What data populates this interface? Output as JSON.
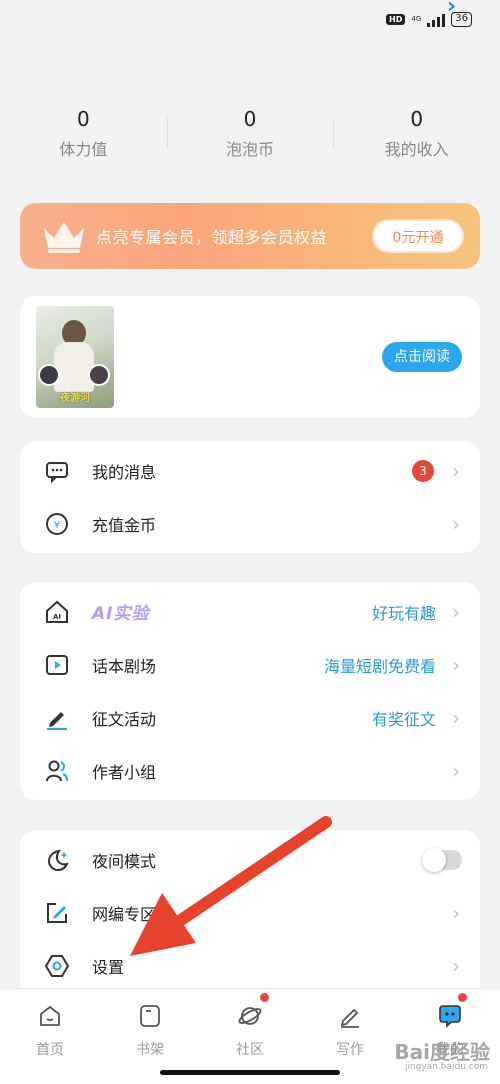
{
  "status_bar": {
    "hd": "HD",
    "network": "4G",
    "battery": "36"
  },
  "stats": [
    {
      "value": "0",
      "label": "体力值"
    },
    {
      "value": "0",
      "label": "泡泡币"
    },
    {
      "value": "0",
      "label": "我的收入"
    }
  ],
  "vip_banner": {
    "text": "点亮专属会员，领超多会员权益",
    "button": "0元开通"
  },
  "book_card": {
    "cover_text": "夜游河",
    "read_button": "点击阅读"
  },
  "account_menu": [
    {
      "label": "我的消息",
      "badge": "3"
    },
    {
      "label": "充值金币"
    }
  ],
  "features_menu": [
    {
      "label": "AI实验",
      "extra": "好玩有趣"
    },
    {
      "label": "话本剧场",
      "extra": "海量短剧免费看"
    },
    {
      "label": "征文活动",
      "extra": "有奖征文"
    },
    {
      "label": "作者小组"
    }
  ],
  "settings_menu": [
    {
      "label": "夜间模式"
    },
    {
      "label": "网编专区"
    },
    {
      "label": "设置"
    }
  ],
  "tabs": [
    {
      "label": "首页"
    },
    {
      "label": "书架"
    },
    {
      "label": "社区"
    },
    {
      "label": "写作"
    },
    {
      "label": "我的"
    }
  ],
  "watermark": {
    "brand": "Bai度经验",
    "url": "jingyan.baidu.com"
  },
  "colors": {
    "accent_blue": "#2aa7ee",
    "badge_red": "#e2483a",
    "vip_orange": "#fba57a",
    "arrow_red": "#e8412c"
  }
}
